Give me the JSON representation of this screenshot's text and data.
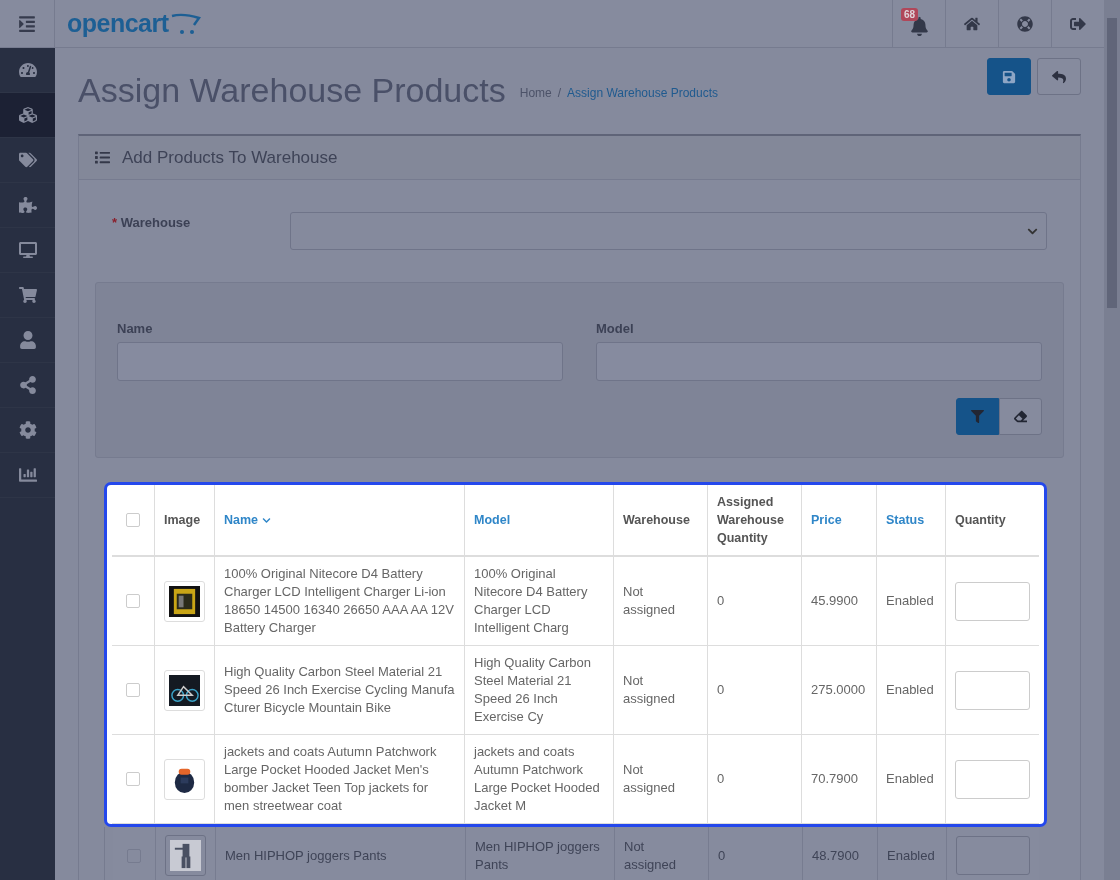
{
  "header": {
    "logo": "opencart",
    "notification_count": "68"
  },
  "sidebar": {
    "items": [
      {
        "selected": false
      },
      {
        "selected": true
      },
      {
        "selected": false
      },
      {
        "selected": false
      },
      {
        "selected": false
      },
      {
        "selected": false
      },
      {
        "selected": false
      },
      {
        "selected": false
      },
      {
        "selected": false
      },
      {
        "selected": false
      }
    ]
  },
  "page": {
    "title": "Assign Warehouse Products",
    "breadcrumb": [
      {
        "label": "Home",
        "current": false
      },
      {
        "label": "Assign Warehouse Products",
        "current": true
      }
    ],
    "breadcrumb_separator": "/"
  },
  "panel": {
    "title": "Add Products To Warehouse",
    "warehouse_label": "Warehouse",
    "warehouse_required": true,
    "required_marker": "*"
  },
  "filter": {
    "fields": [
      {
        "label": "Name"
      },
      {
        "label": "Model"
      }
    ]
  },
  "table": {
    "select_all_checked": false,
    "columns": [
      {
        "label": "Image",
        "sortable": false,
        "sorted": false
      },
      {
        "label": "Name",
        "sortable": true,
        "sorted": true
      },
      {
        "label": "Model",
        "sortable": true,
        "sorted": false
      },
      {
        "label": "Warehouse",
        "sortable": false,
        "sorted": false
      },
      {
        "label": "Assigned Warehouse Quantity",
        "sortable": false,
        "sorted": false
      },
      {
        "label": "Price",
        "sortable": true,
        "sorted": false
      },
      {
        "label": "Status",
        "sortable": true,
        "sorted": false
      },
      {
        "label": "Quantity",
        "sortable": false,
        "sorted": false
      }
    ],
    "rows": [
      {
        "highlighted": true,
        "checked": false,
        "name": "100% Original Nitecore D4 Battery Charger LCD Intelligent Charger Li-ion 18650 14500 16340 26650 AAA AA 12V Battery Charger",
        "model": "100% Original Nitecore D4 Battery Charger LCD Intelligent Charg",
        "warehouse": "Not assigned",
        "assigned_quantity": "0",
        "price": "45.9900",
        "status": "Enabled"
      },
      {
        "highlighted": true,
        "checked": false,
        "name": "High Quality Carbon Steel Material 21 Speed 26 Inch Exercise Cycling Manufa Cturer Bicycle Mountain Bike",
        "model": "High Quality Carbon Steel Material 21 Speed 26 Inch Exercise Cy",
        "warehouse": "Not assigned",
        "assigned_quantity": "0",
        "price": "275.0000",
        "status": "Enabled"
      },
      {
        "highlighted": true,
        "checked": false,
        "name": "jackets and coats Autumn Patchwork Large Pocket Hooded Jacket Men's bomber Jacket Teen Top jackets for men streetwear coat",
        "model": "jackets and coats Autumn Patchwork Large Pocket Hooded Jacket M",
        "warehouse": "Not assigned",
        "assigned_quantity": "0",
        "price": "70.7900",
        "status": "Enabled"
      },
      {
        "highlighted": false,
        "checked": false,
        "name": "Men HIPHOP joggers Pants",
        "model": "Men HIPHOP joggers Pants",
        "warehouse": "Not assigned",
        "assigned_quantity": "0",
        "price": "48.7900",
        "status": "Enabled"
      }
    ]
  }
}
